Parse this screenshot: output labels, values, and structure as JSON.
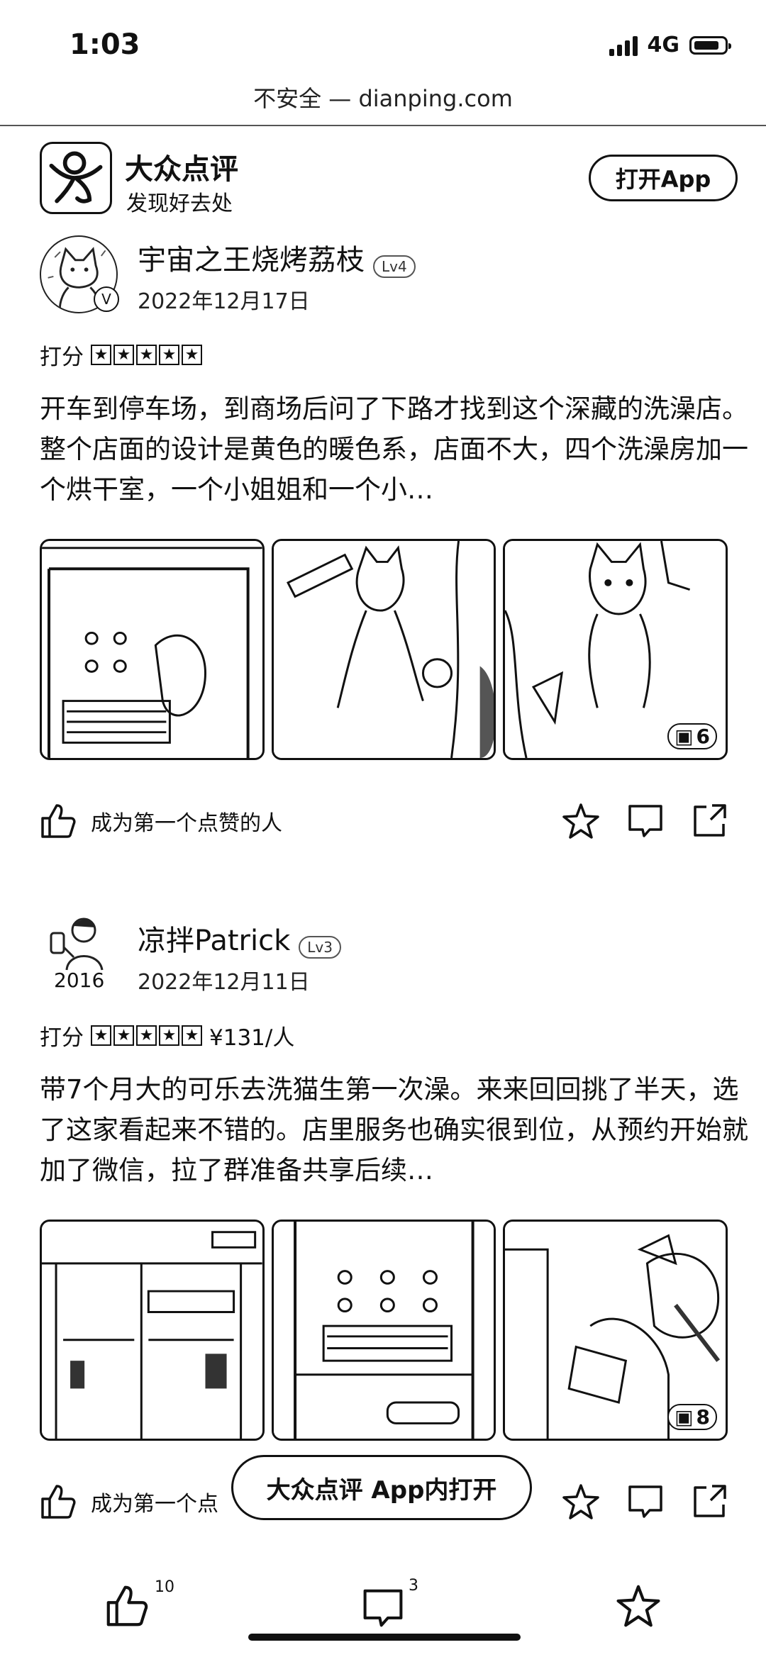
{
  "status_bar": {
    "time": "1:03",
    "network": "4G"
  },
  "browser": {
    "url": "不安全 — dianping.com"
  },
  "header": {
    "title": "大众点评",
    "subtitle": "发现好去处",
    "open_app": "打开App"
  },
  "reviews": [
    {
      "username": "宇宙之王烧烤荔枝",
      "level": "Lv4",
      "date": "2022年12月17日",
      "rating_label": "打分",
      "rating": 5,
      "price": "",
      "text": "开车到停车场，到商场后问了下路才找到这个深藏的洗澡店。整个店面的设计是黄色的暖色系，店面不大，四个洗澡房加一个烘干室，一个小姐姐和一个小…",
      "photo_count": "6",
      "like_text": "成为第一个点赞的人"
    },
    {
      "username": "凉拌Patrick",
      "level": "Lv3",
      "date": "2022年12月11日",
      "avatar_caption": "2016",
      "rating_label": "打分",
      "rating": 5,
      "price": "¥131/人",
      "text": "带7个月大的可乐去洗猫生第一次澡。来来回回挑了半天，选了这家看起来不错的。店里服务也确实很到位，从预约开始就加了微信，拉了群准备共享后续…",
      "photo_count": "8",
      "like_text": "成为第一个点"
    }
  ],
  "floating_banner": "大众点评 App内打开",
  "bottom_bar": {
    "like_count": "10",
    "comment_count": "3"
  }
}
